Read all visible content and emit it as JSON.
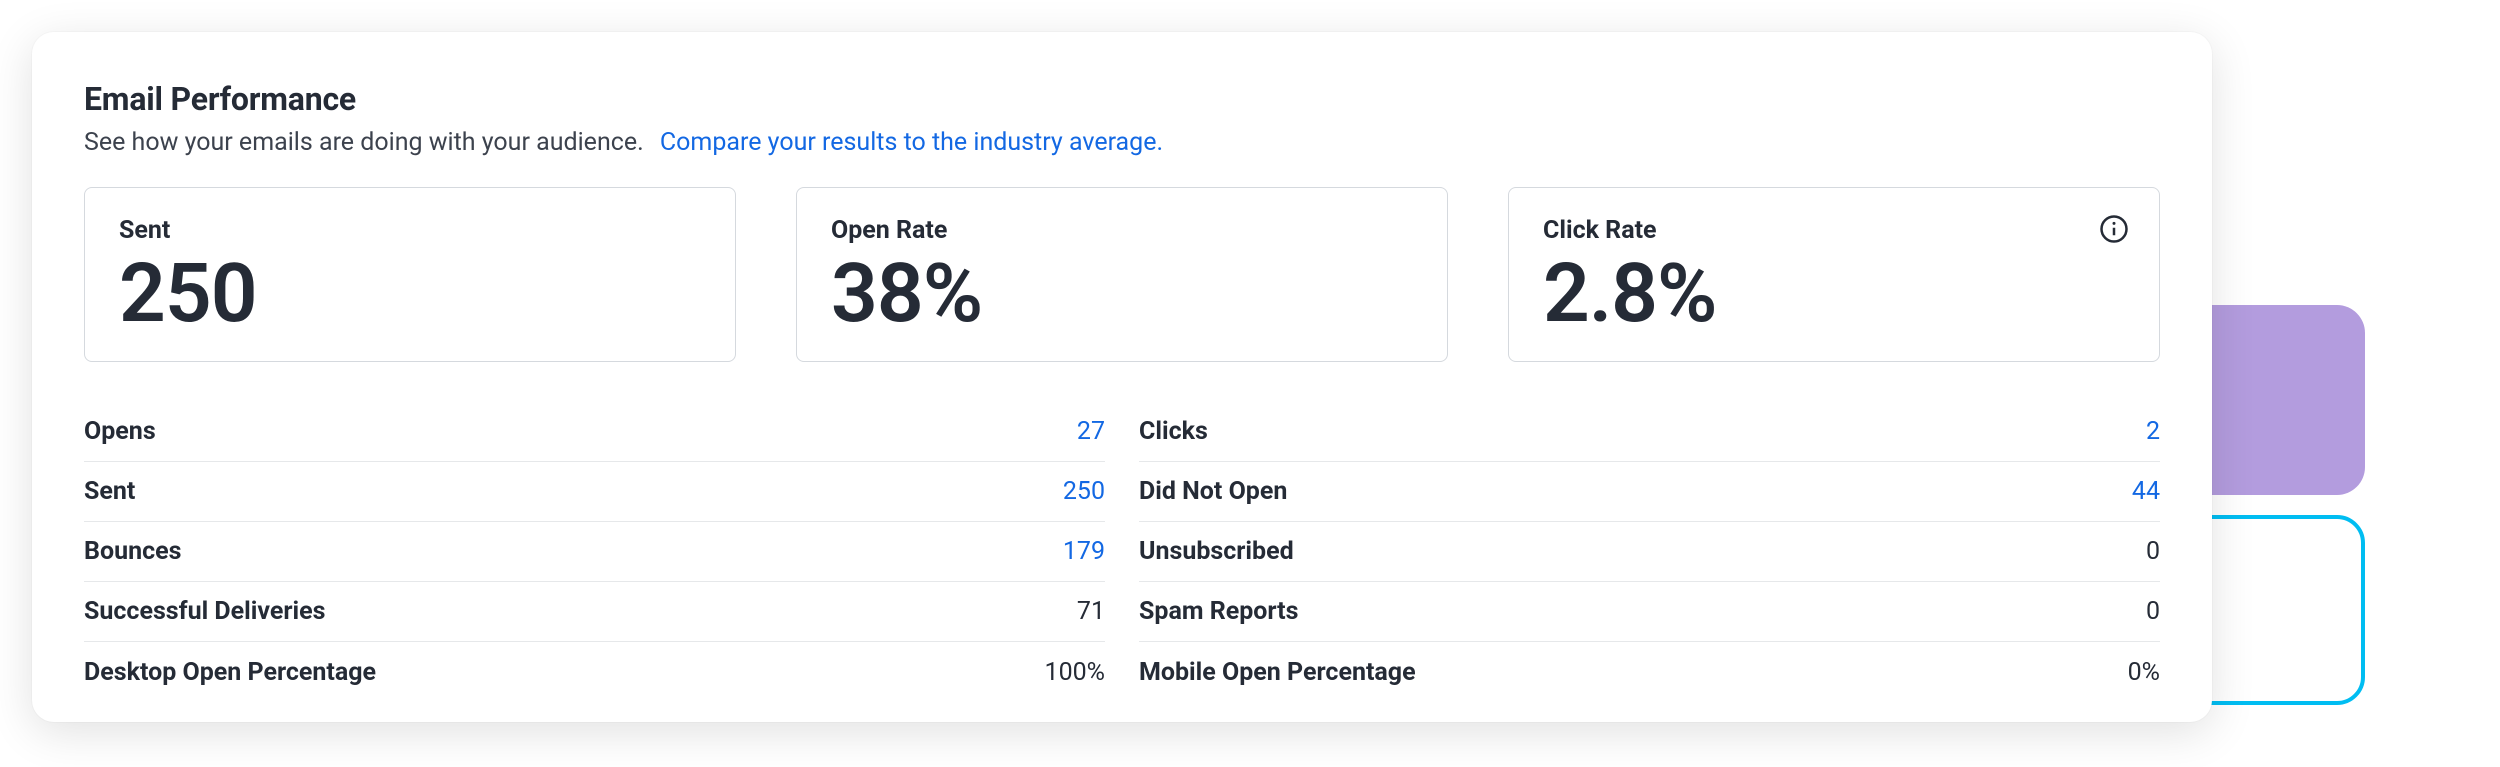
{
  "panel": {
    "title": "Email Performance",
    "subtitle": "See how your emails are doing with your audience.",
    "compare_link": "Compare your results to the industry average."
  },
  "cards": {
    "sent": {
      "label": "Sent",
      "value": "250"
    },
    "open": {
      "label": "Open Rate",
      "value": "38%"
    },
    "click": {
      "label": "Click Rate",
      "value": "2.8%"
    }
  },
  "stats_left": [
    {
      "label": "Opens",
      "value": "27",
      "link": true
    },
    {
      "label": "Sent",
      "value": "250",
      "link": true
    },
    {
      "label": "Bounces",
      "value": "179",
      "link": true
    },
    {
      "label": "Successful Deliveries",
      "value": "71",
      "link": false
    },
    {
      "label": "Desktop Open Percentage",
      "value": "100%",
      "link": false
    }
  ],
  "stats_right": [
    {
      "label": "Clicks",
      "value": "2",
      "link": true
    },
    {
      "label": "Did Not Open",
      "value": "44",
      "link": true
    },
    {
      "label": "Unsubscribed",
      "value": "0",
      "link": false
    },
    {
      "label": "Spam Reports",
      "value": "0",
      "link": false
    },
    {
      "label": "Mobile Open Percentage",
      "value": "0%",
      "link": false
    }
  ],
  "colors": {
    "link": "#1368E3",
    "tile_blue": "#00BDF2",
    "tile_purple": "#B39CDE",
    "tile_navy": "#0C2B50"
  }
}
